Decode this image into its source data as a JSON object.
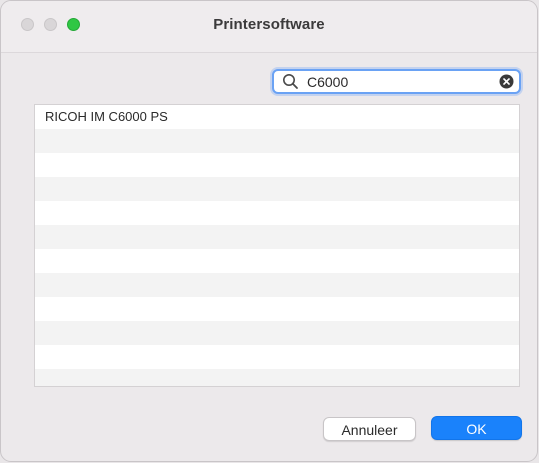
{
  "window": {
    "title": "Printersoftware"
  },
  "search": {
    "value": "C6000"
  },
  "list": {
    "items": [
      "RICOH IM C6000 PS",
      "",
      "",
      "",
      "",
      "",
      "",
      "",
      "",
      "",
      "",
      ""
    ]
  },
  "buttons": {
    "cancel_label": "Annuleer",
    "ok_label": "OK"
  },
  "colors": {
    "accent": "#1a82fb",
    "zoom_green": "#2fc744",
    "focus_ring": "#6aa2f4"
  }
}
